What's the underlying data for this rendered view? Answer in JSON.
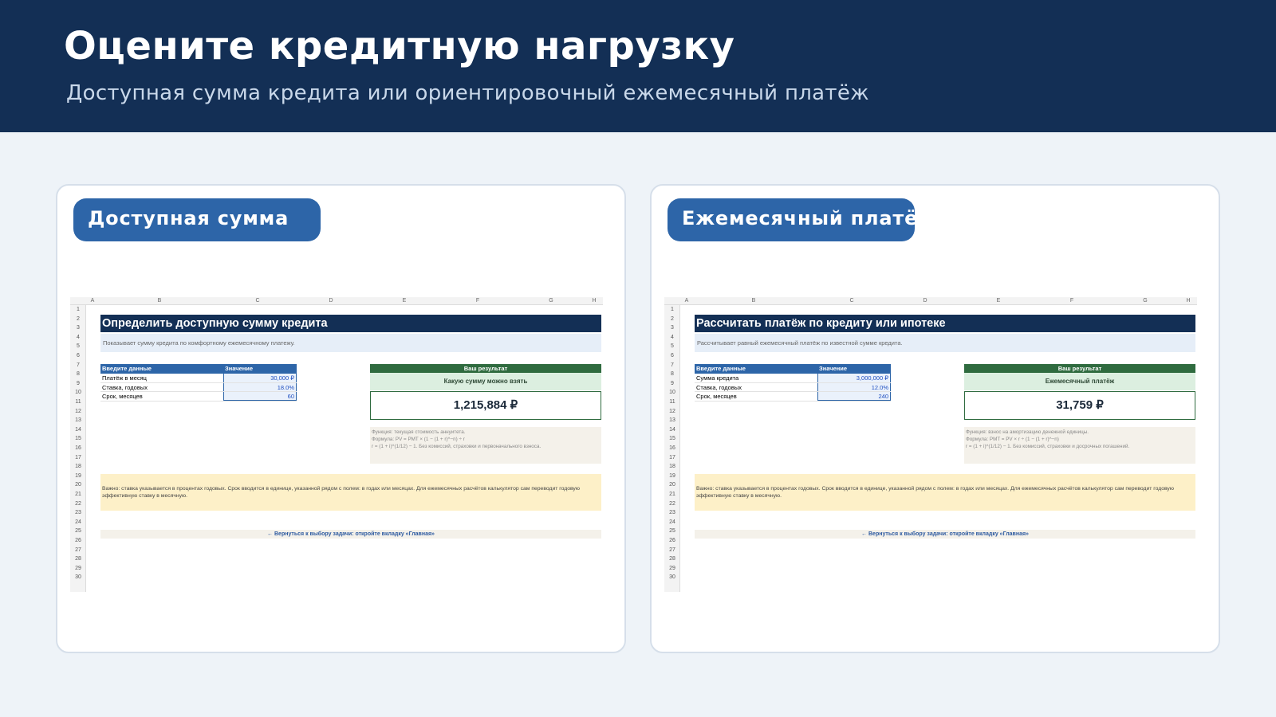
{
  "header": {
    "title": "Оцените кредитную нагрузку",
    "subtitle": "Доступная сумма кредита или ориентировочный ежемесячный платёж"
  },
  "sheet_columns": [
    "A",
    "B",
    "C",
    "D",
    "E",
    "F",
    "G",
    "H"
  ],
  "sheet_rows": [
    "1",
    "2",
    "3",
    "4",
    "5",
    "6",
    "7",
    "8",
    "9",
    "10",
    "11",
    "12",
    "13",
    "14",
    "15",
    "16",
    "17",
    "18",
    "19",
    "20",
    "21",
    "22",
    "23",
    "24",
    "25",
    "26",
    "27",
    "28",
    "29",
    "30"
  ],
  "cards": [
    {
      "label": "Доступная сумма",
      "sheet": {
        "title": "Определить доступную сумму кредита",
        "description": "Показывает сумму кредита по комфортному ежемесячному платежу.",
        "input_header": [
          "Введите данные",
          "Значение"
        ],
        "inputs": [
          {
            "label": "Платёж в месяц",
            "value": "30,000 ₽"
          },
          {
            "label": "Ставка, годовых",
            "value": "18.0%"
          },
          {
            "label": "Срок, месяцев",
            "value": "60"
          }
        ],
        "result_header": "Ваш результат",
        "result_label": "Какую сумму можно взять",
        "result_value": "1,215,884 ₽",
        "formula_lines": [
          "Функция: текущая стоимость аннуитета.",
          "Формула: PV = PMT × (1 − (1 + r)^−n) ÷ r",
          "r = (1 + i)^(1/12) − 1. Без комиссий, страховки и первоначального взноса."
        ],
        "note": "Важно: ставка указывается в процентах годовых. Срок вводится в единице, указанной рядом с полем: в годах или месяцах. Для ежемесячных расчётов калькулятор сам переводит годовую эффективную ставку в месячную.",
        "back_link": "← Вернуться к выбору задачи: откройте вкладку «Главная»"
      }
    },
    {
      "label": "Ежемесячный платёж",
      "sheet": {
        "title": "Рассчитать платёж по кредиту или ипотеке",
        "description": "Рассчитывает равный ежемесячный платёж по известной сумме кредита.",
        "input_header": [
          "Введите данные",
          "Значение"
        ],
        "inputs": [
          {
            "label": "Сумма кредита",
            "value": "3,000,000 ₽"
          },
          {
            "label": "Ставка, годовых",
            "value": "12.0%"
          },
          {
            "label": "Срок, месяцев",
            "value": "240"
          }
        ],
        "result_header": "Ваш результат",
        "result_label": "Ежемесячный платёж",
        "result_value": "31,759 ₽",
        "formula_lines": [
          "Функция: взнос на амортизацию денежной единицы.",
          "Формула: PMT = PV × r ÷ (1 − (1 + r)^−n)",
          "r = (1 + i)^(1/12) − 1. Без комиссий, страховки и досрочных погашений."
        ],
        "note": "Важно: ставка указывается в процентах годовых. Срок вводится в единице, указанной рядом с полем: в годах или месяцах. Для ежемесячных расчётов калькулятор сам переводит годовую эффективную ставку в месячную.",
        "back_link": "← Вернуться к выбору задачи: откройте вкладку «Главная»"
      }
    }
  ]
}
